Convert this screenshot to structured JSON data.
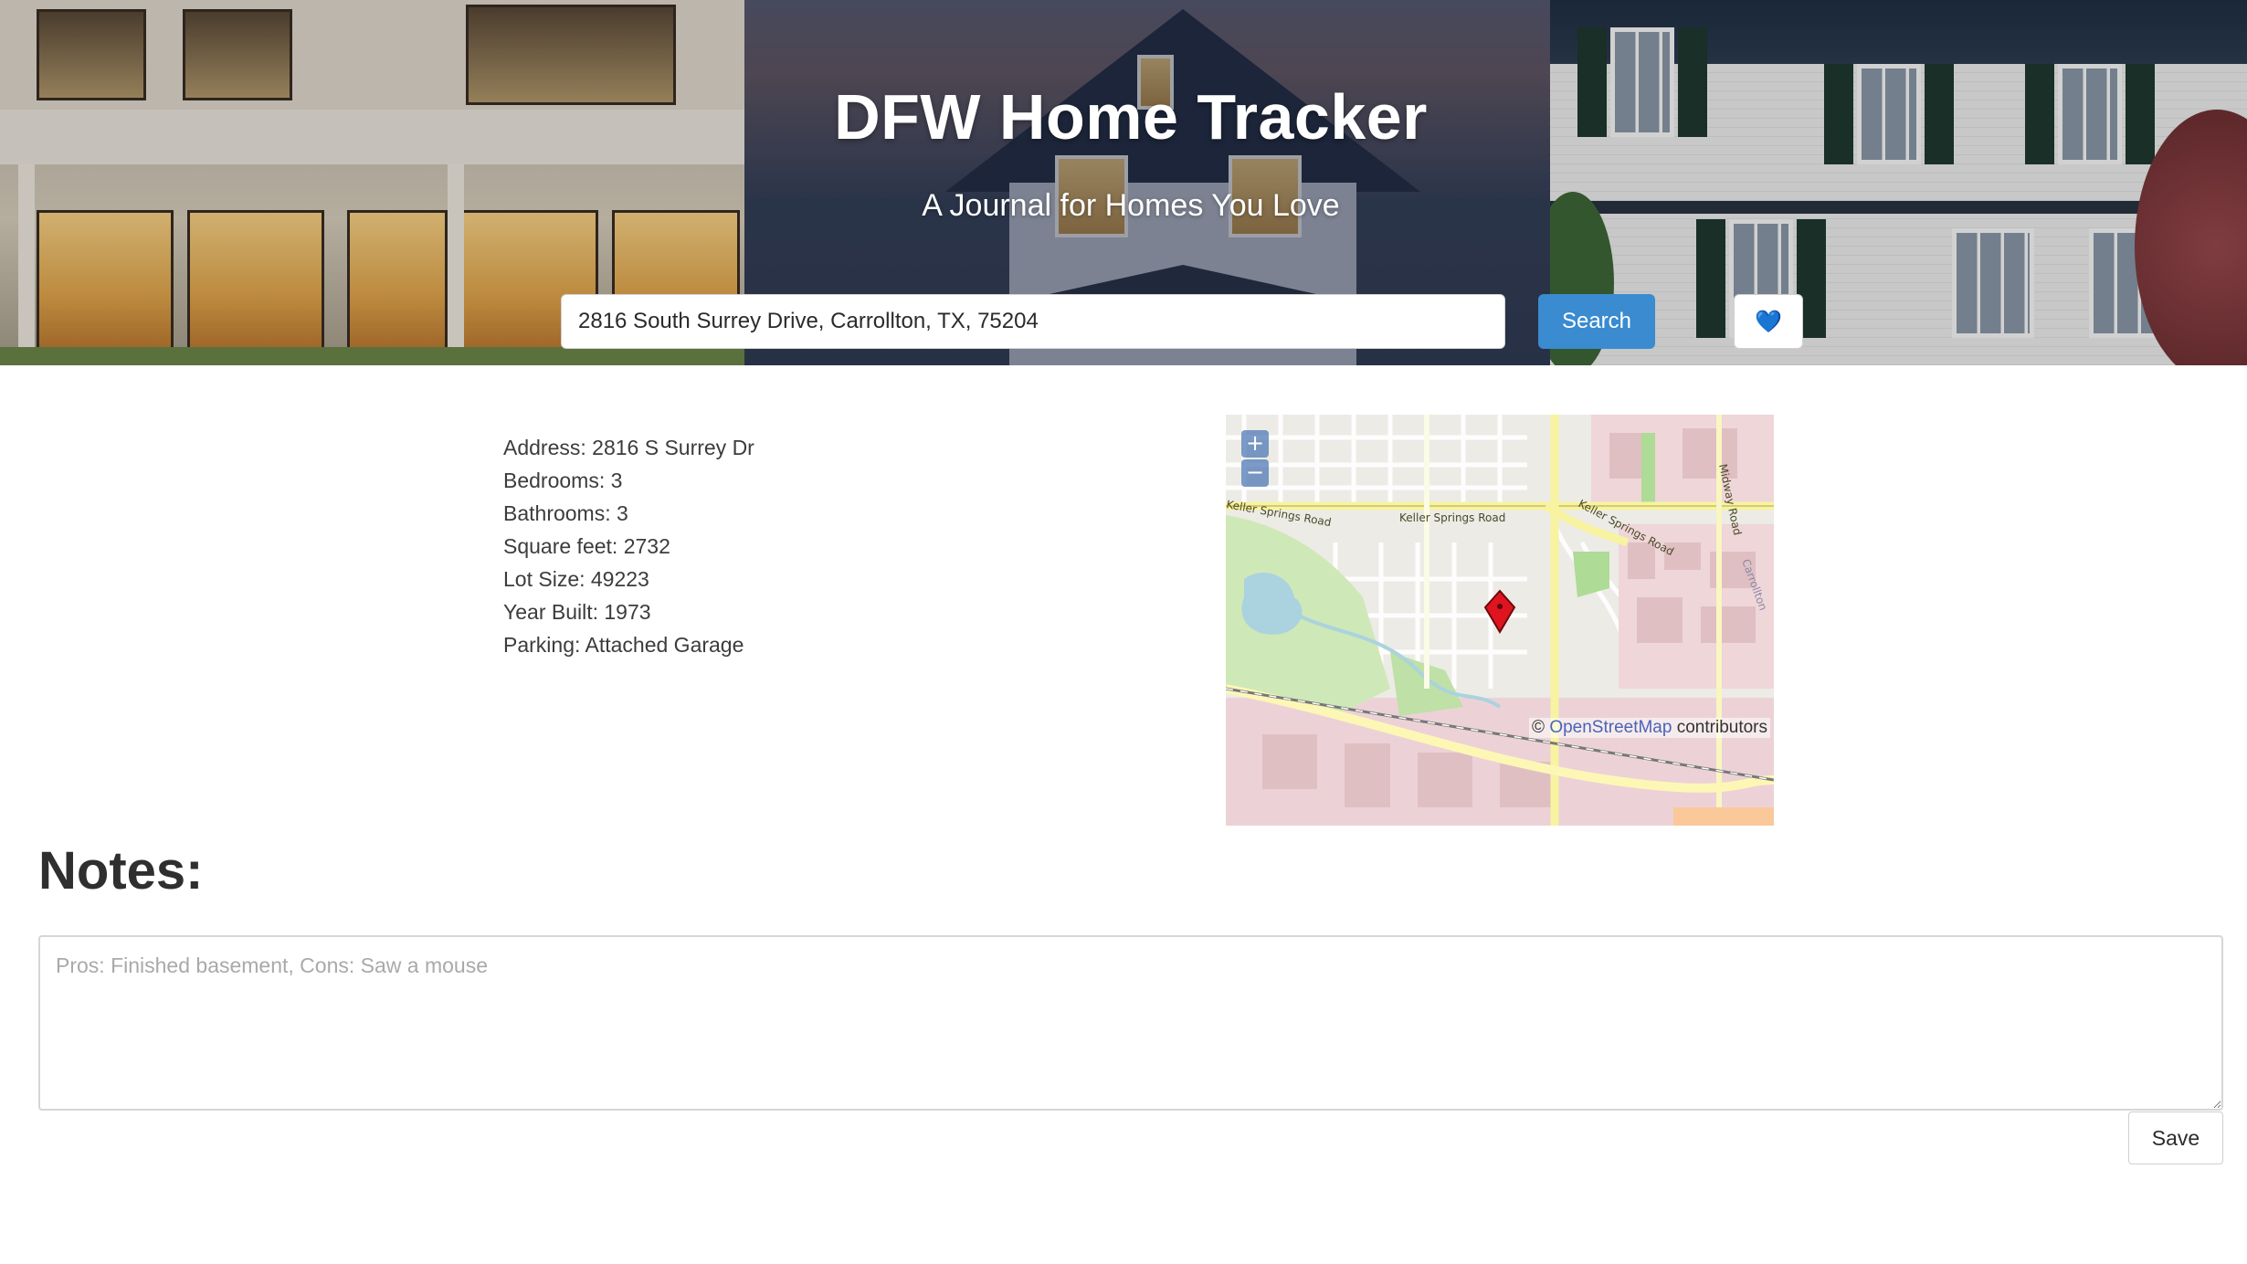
{
  "hero": {
    "title": "DFW Home Tracker",
    "subtitle": "A Journal for Homes You Love"
  },
  "search": {
    "value": "2816 South Surrey Drive, Carrollton, TX, 75204",
    "button_label": "Search"
  },
  "favorite": {
    "icon": "blue-heart-icon",
    "glyph": "💙"
  },
  "details": {
    "address": "Address: 2816 S Surrey Dr",
    "bedrooms": "Bedrooms: 3",
    "bathrooms": "Bathrooms: 3",
    "square_feet": "Square feet: 2732",
    "lot_size": "Lot Size: 49223",
    "year_built": "Year Built: 1973",
    "parking": "Parking: Attached Garage"
  },
  "map": {
    "zoom_in": "+",
    "zoom_out": "−",
    "road_labels": [
      "Keller Springs Road",
      "Keller Springs Road",
      "Keller Springs Road",
      "Midway Road",
      "Carrollton"
    ],
    "attribution_prefix": "© ",
    "attribution_link": "OpenStreetMap",
    "attribution_suffix": " contributors"
  },
  "notes": {
    "title": "Notes:",
    "placeholder": "Pros: Finished basement, Cons: Saw a mouse",
    "save_label": "Save"
  },
  "colors": {
    "accent": "#3a8bd0",
    "heart": "#1e6fd0",
    "marker": "#e0141e"
  }
}
